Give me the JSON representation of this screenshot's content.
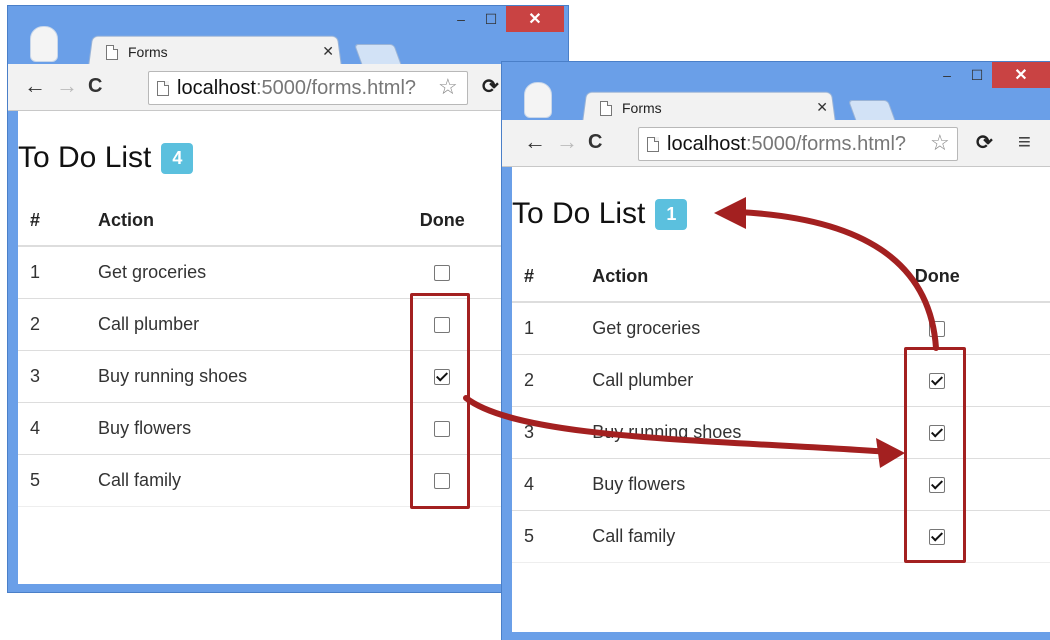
{
  "windows": [
    {
      "tab_title": "Forms",
      "url_host": "localhost",
      "url_path": ":5000/forms.html?",
      "heading": "To Do List",
      "badge": "4",
      "table": {
        "headers": [
          "#",
          "Action",
          "Done"
        ],
        "rows": [
          {
            "num": "1",
            "action": "Get groceries",
            "done": false
          },
          {
            "num": "2",
            "action": "Call plumber",
            "done": false
          },
          {
            "num": "3",
            "action": "Buy running shoes",
            "done": true
          },
          {
            "num": "4",
            "action": "Buy flowers",
            "done": false
          },
          {
            "num": "5",
            "action": "Call family",
            "done": false
          }
        ]
      }
    },
    {
      "tab_title": "Forms",
      "url_host": "localhost",
      "url_path": ":5000/forms.html?",
      "heading": "To Do List",
      "badge": "1",
      "table": {
        "headers": [
          "#",
          "Action",
          "Done"
        ],
        "rows": [
          {
            "num": "1",
            "action": "Get groceries",
            "done": false
          },
          {
            "num": "2",
            "action": "Call plumber",
            "done": true
          },
          {
            "num": "3",
            "action": "Buy running shoes",
            "done": true
          },
          {
            "num": "4",
            "action": "Buy flowers",
            "done": true
          },
          {
            "num": "5",
            "action": "Call family",
            "done": true
          }
        ]
      }
    }
  ],
  "colors": {
    "frame": "#6a9fe8",
    "badge": "#5bc0de",
    "annotation": "#a32020",
    "close_button": "#c94343"
  }
}
